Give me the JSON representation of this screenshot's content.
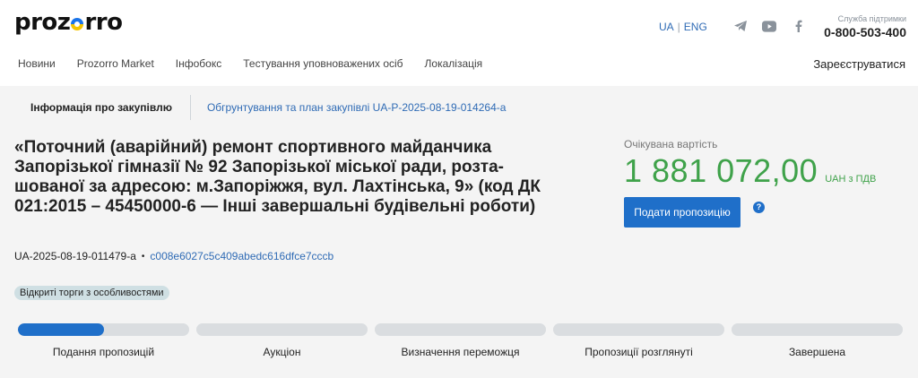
{
  "header": {
    "logo_left": "proz",
    "logo_right": "rro",
    "lang_ua": "UA",
    "lang_sep": "|",
    "lang_eng": "ENG",
    "support_label": "Служба підтримки",
    "support_phone": "0-800-503-400"
  },
  "nav": {
    "items": [
      "Новини",
      "Prozorro Market",
      "Інфобокс",
      "Тестування уповноважених осіб",
      "Локалізація"
    ],
    "register": "Зареєструватися"
  },
  "tabs": {
    "active": "Інформація про закупівлю",
    "link": "Обгрунтування та план закупівлі UA-P-2025-08-19-014264-a"
  },
  "tender": {
    "title": "«Поточний (аварійний) ремонт спортивного майданчика Запорізької гімназії № 92 Запорізької міської ради, розта-шованої за адресою: м.Запоріжжя, вул. Лахтінська, 9» (код ДК 021:2015 – 45450000-6 — Інші завершальні будівельні роботи)",
    "id": "UA-2025-08-19-011479-a",
    "bullet": "•",
    "hash": "c008e6027c5c409abedc616dfce7cccb",
    "procedure": "Відкриті торги з особливостями"
  },
  "price": {
    "label": "Очікувана вартість",
    "value": "1 881 072,00",
    "currency": "UAH з ПДВ",
    "button": "Подати пропозицію",
    "help": "?"
  },
  "progress": {
    "steps": [
      {
        "label": "Подання пропозицій",
        "fill": 0.5
      },
      {
        "label": "Аукціон",
        "fill": 0
      },
      {
        "label": "Визначення переможця",
        "fill": 0
      },
      {
        "label": "Пропозиції розглянуті",
        "fill": 0
      },
      {
        "label": "Завершена",
        "fill": 0
      }
    ]
  },
  "colors": {
    "accent": "#1f6fc9",
    "price": "#3fa24a",
    "link": "#2f6bb5"
  },
  "icons": [
    "telegram-icon",
    "youtube-icon",
    "facebook-icon",
    "help-icon"
  ]
}
